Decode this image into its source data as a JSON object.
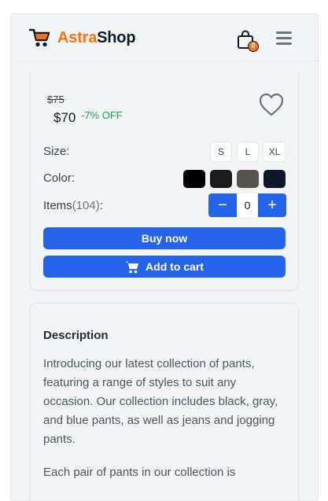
{
  "header": {
    "brand_part1": "Astra",
    "brand_part2": "Shop",
    "cart_count": "0",
    "icons": [
      "shopping-cart-icon",
      "shopping-bag-icon",
      "hamburger-menu-icon"
    ]
  },
  "product": {
    "old_price": "$75",
    "price": "$70",
    "discount": "-7% OFF",
    "wishlist_icon": "heart-icon",
    "size_label": "Size:",
    "sizes": [
      "S",
      "L",
      "XL"
    ],
    "color_label": "Color:",
    "colors": [
      "#000000",
      "#1c1c1c",
      "#57534e",
      "#0f172a"
    ],
    "items_label": "Items",
    "items_count": "(104)",
    "items_colon": ":",
    "quantity": "0",
    "minus_label": "−",
    "plus_label": "+",
    "buy_now": "Buy now",
    "add_to_cart": "Add to cart"
  },
  "description": {
    "title": "Description",
    "paragraph1": "Introducing our latest collection of pants, featuring a range of styles to suit any occasion. Our collection includes black, gray, and blue pants, as well as jeans and jogging pants.",
    "paragraph2": "Each pair of pants in our collection is"
  },
  "colors": {
    "accent": "#2563eb",
    "brand_orange": "#f97316",
    "discount_green": "#16a34a"
  }
}
